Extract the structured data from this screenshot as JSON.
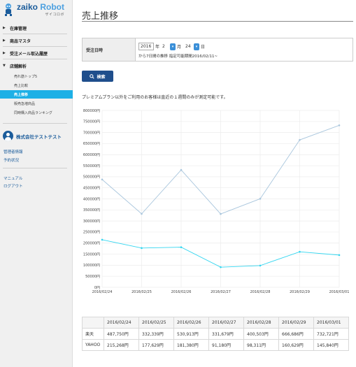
{
  "brand": {
    "name_main": "zaiko",
    "name_accent": "Robot",
    "sub": "ザイコロボ"
  },
  "nav": {
    "items": [
      {
        "label": "在庫管理"
      },
      {
        "label": "商品マスタ"
      },
      {
        "label": "受注メール取込履歴"
      },
      {
        "label": "店舗解析"
      }
    ],
    "sub_items": [
      {
        "label": "売れ筋トップ5"
      },
      {
        "label": "売上比較"
      },
      {
        "label": "売上推移"
      },
      {
        "label": "販売急増商品"
      },
      {
        "label": "同時購入商品ランキング"
      }
    ],
    "active_sub": "売上推移"
  },
  "account": {
    "company": "株式会社テストテスト",
    "links": [
      "管理者情報",
      "予約状況"
    ],
    "links2": [
      "マニュアル",
      "ログアウト"
    ]
  },
  "page": {
    "title": "売上推移"
  },
  "filter": {
    "label": "受注日時",
    "year": "2016",
    "year_unit": "年",
    "month": "2",
    "month_unit": "月",
    "day": "24",
    "day_unit": "日",
    "note": "から7日間の推移  指定可能期間2016/02/11~"
  },
  "search_button": {
    "label": "検索",
    "icon": "search-icon"
  },
  "notice": "プレミアムプラン以外をご利用のお客様は直近の１週間のみが測定可能です。",
  "chart_data": {
    "type": "line",
    "categories": [
      "2016/02/24",
      "2016/02/25",
      "2016/02/26",
      "2016/02/27",
      "2016/02/28",
      "2016/02/29",
      "2016/03/01"
    ],
    "y_ticks": [
      "0円",
      "50000円",
      "100000円",
      "150000円",
      "200000円",
      "250000円",
      "300000円",
      "350000円",
      "400000円",
      "450000円",
      "500000円",
      "550000円",
      "600000円",
      "650000円",
      "700000円",
      "750000円",
      "800000円"
    ],
    "ylim": [
      0,
      800000
    ],
    "series": [
      {
        "name": "楽天",
        "values": [
          487750,
          332339,
          530913,
          331679,
          400503,
          666686,
          732721
        ],
        "color": "#a9c6dd"
      },
      {
        "name": "YAHOO",
        "values": [
          215268,
          177629,
          181380,
          91180,
          98311,
          160629,
          145840
        ],
        "color": "#33d6f0"
      }
    ],
    "grid": true
  },
  "table": {
    "headers": [
      "",
      "2016/02/24",
      "2016/02/25",
      "2016/02/26",
      "2016/02/27",
      "2016/02/28",
      "2016/02/29",
      "2016/03/01"
    ],
    "rows": [
      [
        "楽天",
        "487,750円",
        "332,339円",
        "530,913円",
        "331,679円",
        "400,503円",
        "666,686円",
        "732,721円"
      ],
      [
        "YAHOO",
        "215,268円",
        "177,629円",
        "181,380円",
        "91,180円",
        "98,311円",
        "160,629円",
        "145,840円"
      ]
    ]
  },
  "colors": {
    "accent": "#1eb0e6",
    "brand": "#1b5c9b",
    "button": "#1f4e8c"
  }
}
